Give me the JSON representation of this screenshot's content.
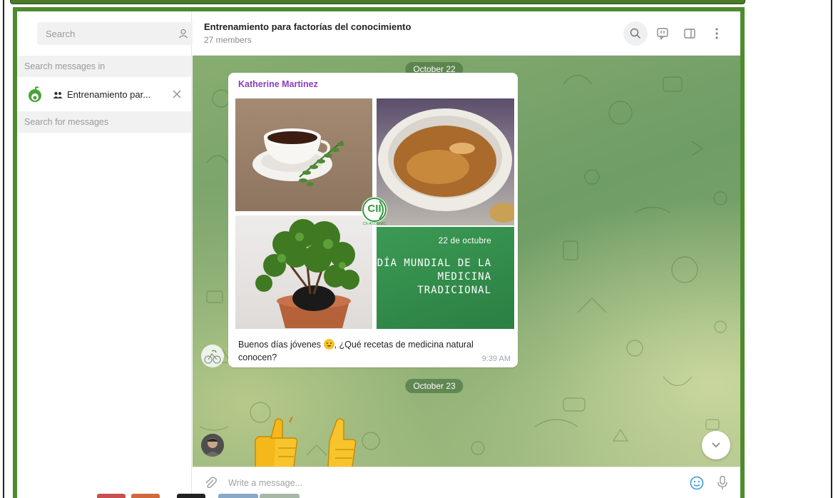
{
  "sidebar": {
    "search_placeholder": "Search",
    "search_messages_in_label": "Search messages in",
    "chat_filter_label": "Entrenamiento par...",
    "search_for_messages_label": "Search for messages"
  },
  "header": {
    "title": "Entrenamiento para factorías del conocimiento",
    "subtitle": "27 members"
  },
  "messages": {
    "date_1": "October 22",
    "sender": "Katherine Martinez",
    "poster_date": "22 de octubre",
    "poster_title_line1": "DÍA MUNDIAL DE LA",
    "poster_title_line2": "MEDICINA",
    "poster_title_line3": "TRADICIONAL",
    "poster_logo_text": "CII",
    "poster_logo_caption": "CII-ASDENIC",
    "text_part1": "Buenos días jóvenes",
    "text_part2": ", ¿Qué recetas de medicina natural conocen?",
    "time": "9:39 AM",
    "date_2": "October 23"
  },
  "composer": {
    "placeholder": "Write a message..."
  },
  "colors": {
    "frame_green": "#4f8a2e",
    "sender_purple": "#8b3fbb",
    "poster_green": "#2f8a4a",
    "date_pill": "#50784680"
  },
  "icons": [
    "menu-icon",
    "contacts-icon",
    "calendar-icon",
    "group-icon",
    "close-icon",
    "search-icon",
    "comments-icon",
    "sidebar-toggle-icon",
    "more-icon",
    "attach-icon",
    "emoji-icon",
    "mic-icon",
    "chevron-down-icon",
    "thumbs-up-icon"
  ]
}
